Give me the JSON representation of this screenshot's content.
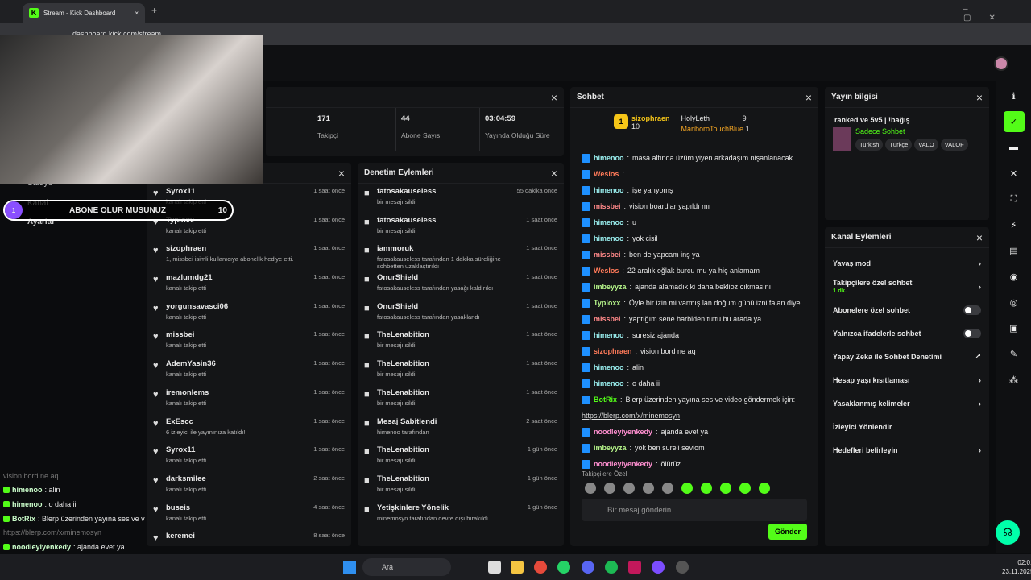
{
  "browser": {
    "tab_title": "Stream - Kick Dashboard",
    "url": "dashboard.kick.com/stream"
  },
  "stats": [
    {
      "value": "171",
      "label": "Takipçi"
    },
    {
      "value": "44",
      "label": "Abone Sayısı"
    },
    {
      "value": "03:04:59",
      "label": "Yayında Olduğu Süre"
    }
  ],
  "leftnav": {
    "item1": "Stüdyo",
    "item2": "Kanal",
    "item3": "Ayarlar"
  },
  "overlay": {
    "num": "1",
    "text": "ABONE OLUR MUSUNUZ",
    "count": "10"
  },
  "activity": [
    {
      "name": "Syrox11",
      "desc": "kanalı takip etti",
      "time": "1 saat önce"
    },
    {
      "name": "Typloxx",
      "desc": "kanalı takip etti",
      "time": "1 saat önce"
    },
    {
      "name": "sizophraen",
      "desc": "1, missbei isimli kullanıcıya abonelik hediye etti.",
      "time": "1 saat önce"
    },
    {
      "name": "mazlumdg21",
      "desc": "kanalı takip etti",
      "time": "1 saat önce"
    },
    {
      "name": "yorgunsavasci06",
      "desc": "kanalı takip etti",
      "time": "1 saat önce"
    },
    {
      "name": "missbei",
      "desc": "kanalı takip etti",
      "time": "1 saat önce"
    },
    {
      "name": "AdemYasin36",
      "desc": "kanalı takip etti",
      "time": "1 saat önce"
    },
    {
      "name": "iremonlems",
      "desc": "kanalı takip etti",
      "time": "1 saat önce"
    },
    {
      "name": "ExEscc",
      "desc": "6 izleyici ile yayınınıza katıldı!",
      "time": "1 saat önce"
    },
    {
      "name": "Syrox11",
      "desc": "kanalı takip etti",
      "time": "1 saat önce"
    },
    {
      "name": "darksmilee",
      "desc": "kanalı takip etti",
      "time": "2 saat önce"
    },
    {
      "name": "buseis",
      "desc": "kanalı takip etti",
      "time": "4 saat önce"
    },
    {
      "name": "keremei",
      "desc": "",
      "time": "8 saat önce"
    }
  ],
  "moderation": {
    "title": "Denetim Eylemleri",
    "items": [
      {
        "name": "fatosakauseless",
        "desc": "bir mesajı sildi",
        "time": "55 dakika önce",
        "icon": "trash-icon"
      },
      {
        "name": "fatosakauseless",
        "desc": "bir mesajı sildi",
        "time": "1 saat önce",
        "icon": "trash-icon"
      },
      {
        "name": "iammoruk",
        "desc": "fatosakauseless tarafından 1 dakika süreliğine sohbetten uzaklaştırıldı",
        "time": "1 saat önce",
        "icon": "hourglass-icon"
      },
      {
        "name": "OnurShield",
        "desc": "fatosakauseless tarafından yasağı kaldırıldı",
        "time": "1 saat önce",
        "icon": "undo-icon"
      },
      {
        "name": "OnurShield",
        "desc": "fatosakauseless tarafından yasaklandı",
        "time": "1 saat önce",
        "icon": "ban-icon"
      },
      {
        "name": "TheLenabition",
        "desc": "bir mesajı sildi",
        "time": "1 saat önce",
        "icon": "trash-icon"
      },
      {
        "name": "TheLenabition",
        "desc": "bir mesajı sildi",
        "time": "1 saat önce",
        "icon": "trash-icon"
      },
      {
        "name": "TheLenabition",
        "desc": "bir mesajı sildi",
        "time": "1 saat önce",
        "icon": "trash-icon"
      },
      {
        "name": "Mesaj Sabitlendi",
        "desc": "himenoo tarafından",
        "time": "2 saat önce",
        "icon": "pin-icon"
      },
      {
        "name": "TheLenabition",
        "desc": "bir mesajı sildi",
        "time": "1 gün önce",
        "icon": "trash-icon"
      },
      {
        "name": "TheLenabition",
        "desc": "bir mesajı sildi",
        "time": "1 gün önce",
        "icon": "trash-icon"
      },
      {
        "name": "Yetişkinlere Yönelik",
        "desc": "minemosyn tarafından devre dışı bırakıldı",
        "time": "1 gün önce",
        "icon": "eye-icon"
      }
    ]
  },
  "chat": {
    "title": "Sohbet",
    "top": [
      {
        "rank": "1",
        "name": "sizophraen",
        "count": "10"
      },
      {
        "name": "HolyLeth",
        "count": "9"
      },
      {
        "name": "MariboroTouchBlue",
        "count": "1"
      }
    ],
    "lines": [
      {
        "user": "himenoo",
        "msg": "masa altında üzüm yiyen arkadaşım nişanlanacak",
        "color": "#9ee"
      },
      {
        "user": "Weslos",
        "msg": "",
        "color": "#ff7a59"
      },
      {
        "user": "himenoo",
        "msg": "işe yarıyomş",
        "color": "#9ee"
      },
      {
        "user": "missbei",
        "msg": "vision boardlar yapıldı mı",
        "color": "#f88"
      },
      {
        "user": "himenoo",
        "msg": "u",
        "color": "#9ee"
      },
      {
        "user": "himenoo",
        "msg": "yok cisil",
        "color": "#9ee"
      },
      {
        "user": "missbei",
        "msg": "ben de yapcam inş ya",
        "color": "#f88"
      },
      {
        "user": "Weslos",
        "msg": "22 aralık oğlak burcu mu ya hiç anlamam",
        "color": "#ff7a59"
      },
      {
        "user": "imbeyyza",
        "msg": "ajanda alamadık ki daha beklioz cıkmasını",
        "color": "#b6f58a"
      },
      {
        "user": "Typloxx",
        "msg": "Öyle bir izin mi varmış lan doğum günü izni falan diye",
        "color": "#b6f58a"
      },
      {
        "user": "missbei",
        "msg": "yaptığım sene harbiden tuttu bu arada ya",
        "color": "#f88"
      },
      {
        "user": "himenoo",
        "msg": "suresiz ajanda",
        "color": "#9ee"
      },
      {
        "user": "sizophraen",
        "msg": "vision bord ne aq",
        "color": "#ff7a59"
      },
      {
        "user": "himenoo",
        "msg": "alin",
        "color": "#9ee"
      },
      {
        "user": "himenoo",
        "msg": "o daha ii",
        "color": "#9ee"
      },
      {
        "user": "BotRix",
        "msg": "Blerp üzerinden yayına ses ve video göndermek için:",
        "color": "#53fc18"
      },
      {
        "user": "",
        "msg": "https://blerp.com/x/minemosyn",
        "color": "#ddd"
      },
      {
        "user": "noodleyiyenkedy",
        "msg": "ajanda evet ya",
        "color": "#ff8fd0"
      },
      {
        "user": "imbeyyza",
        "msg": "yok ben sureli seviom",
        "color": "#b6f58a"
      },
      {
        "user": "noodleyiyenkedy",
        "msg": "ölürüz",
        "color": "#ff8fd0"
      }
    ],
    "followers_only": "Takipçilere Özel",
    "placeholder": "Bir mesaj gönderin",
    "send": "Gönder"
  },
  "info": {
    "title": "Yayın bilgisi",
    "stream_title": "ranked ve 5v5 | !bağış",
    "category": "Sadece Sohbet",
    "tags": [
      "Turkish",
      "Türkçe",
      "VALO",
      "VALOF"
    ]
  },
  "actions": {
    "title": "Kanal Eylemleri",
    "items": [
      "Yavaş mod",
      "Takipçilere özel sohbet",
      "Abonelere özel sohbet",
      "Yalnızca ifadelerle sohbet",
      "Yapay Zeka ile Sohbet Denetimi",
      "Hesap yaşı kısıtlaması",
      "Yasaklanmış kelimeler",
      "İzleyici Yönlendir",
      "Hedefleri belirleyin"
    ],
    "sub": "1 dk."
  },
  "bottomchat": [
    {
      "user": "",
      "msg": "vision bord ne aq"
    },
    {
      "user": "himenoo",
      "msg": ": alin"
    },
    {
      "user": "himenoo",
      "msg": ": o daha ii"
    },
    {
      "user": "BotRix",
      "msg": ": Blerp üzerinden yayına ses ve video göndermek için:"
    },
    {
      "user": "",
      "msg": "https://blerp.com/x/minemosyn"
    },
    {
      "user": "noodleyiyenkedy",
      "msg": ": ajanda evet ya"
    },
    {
      "user": "imbeyyza",
      "msg": ": yok ben sureli seviom"
    },
    {
      "user": "noodleyiyenkedy",
      "msg": ": ölürüz"
    }
  ],
  "taskbar": {
    "search": "Ara",
    "time": "02:01",
    "date": "23.11.2025"
  }
}
